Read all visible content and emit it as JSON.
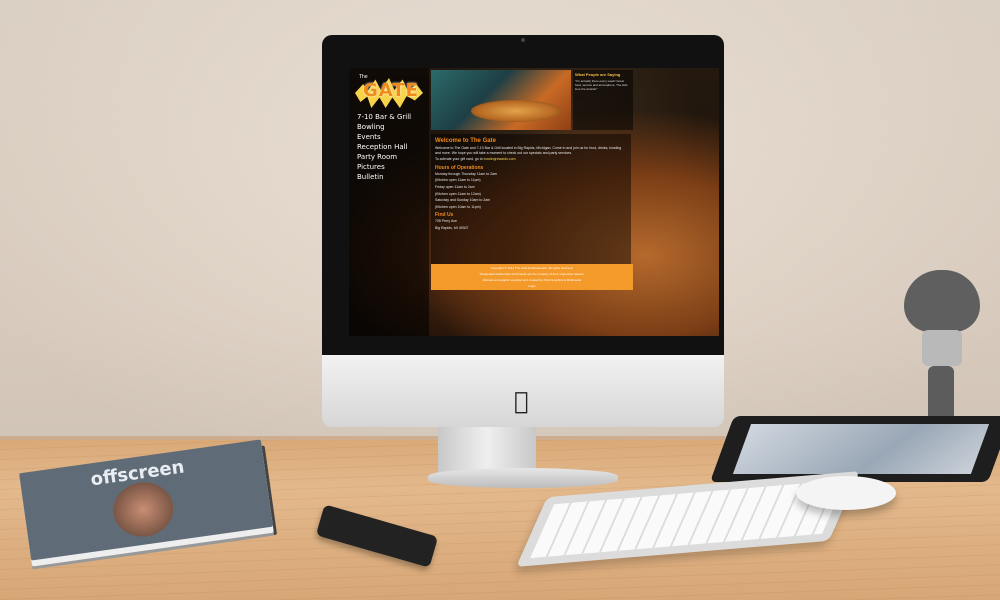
{
  "website": {
    "logo_text": "GATE",
    "logo_small": "The",
    "nav": [
      "7-10 Bar & Grill",
      "Bowling",
      "Events",
      "Reception Hall",
      "Party Room",
      "Pictures",
      "Bulletin"
    ],
    "sidebar_title": "What People are Saying",
    "sidebar_text": "\"I'm actually there every week! Great food, service and atmosphere. The kids love the arcade!\"",
    "content_title": "Welcome to The Gate",
    "content_intro": "Welcome to The Gate and 7-10 Bar & Grill located in Big Rapids, Michigan. Come in and join us for food, drinks, bowling and more. We hope you will take a moment to check out our specials and party services.",
    "gift_card_text": "To activate your gift card, go to",
    "gift_card_link": "bowlingrewards.com",
    "hours_title": "Hours of Operations",
    "hours_lines": [
      "Monday through Thursday 11am to 2am",
      "(Kitchen open 11am to 11pm)",
      "Friday open 11am to 2am",
      "(Kitchen open 11am to 12am)",
      "Saturday and Sunday 10am to 2am",
      "(Kitchen open 10am to 11pm)"
    ],
    "find_title": "Find Us",
    "address_lines": [
      "705 Perry Ave",
      "Big Rapids, MI 49307"
    ],
    "footer_lines": [
      "Copyright © 2014 The Gate Entertainment. All rights reserved.",
      "Designated trademarks and brands are the property of their respective owners.",
      "Website and graphic supplied and created by Prick Graphics & Multimedia",
      "Login"
    ]
  },
  "magazine_title": "offscreen",
  "colors": {
    "accent": "#f08a1a",
    "footer": "#f39a2a"
  }
}
